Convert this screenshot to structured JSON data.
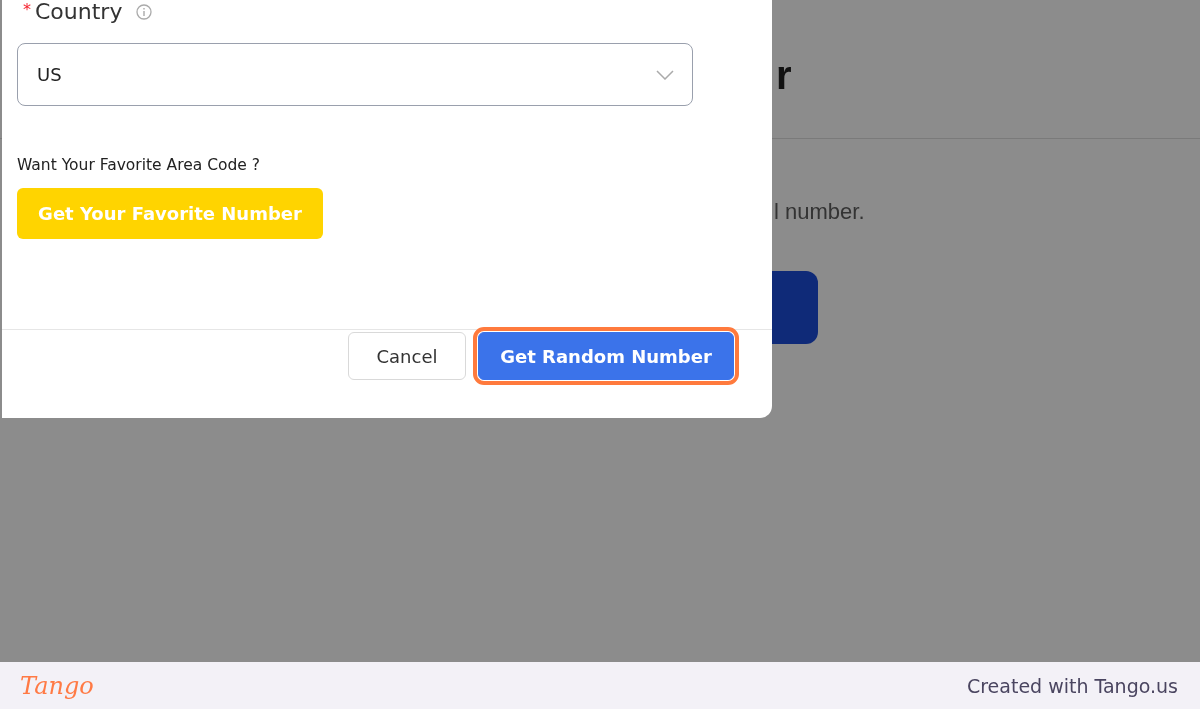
{
  "background_page": {
    "heading": "r",
    "text": "l number."
  },
  "dialog": {
    "field": {
      "required_mark": "*",
      "label": "Country",
      "value": "US"
    },
    "favorite_prompt": "Want Your Favorite Area Code ?",
    "favorite_button": "Get Your Favorite Number",
    "buttons": [
      {
        "label": "Cancel",
        "kind": "secondary",
        "highlighted": false
      },
      {
        "label": "Get Random Number",
        "kind": "primary",
        "highlighted": true
      }
    ]
  },
  "footer": {
    "logo": "Tango",
    "credit": "Created with Tango.us"
  }
}
